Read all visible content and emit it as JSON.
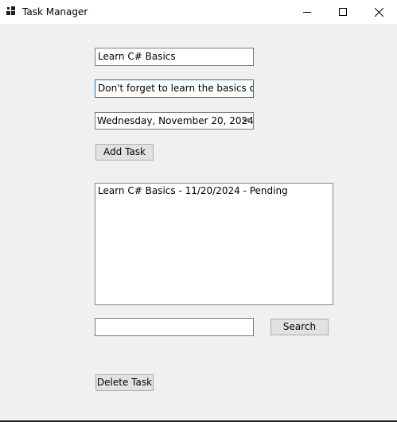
{
  "window": {
    "title": "Task Manager",
    "icon": "app-grid-icon",
    "controls": {
      "minimize_icon": "minimize-icon",
      "maximize_icon": "maximize-icon",
      "close_icon": "close-icon"
    }
  },
  "form": {
    "title_value": "Learn C# Basics",
    "description_value": "Don't forget to learn the basics of C#",
    "due_date_value": "Wednesday, November 20, 2024",
    "add_task_label": "Add Task",
    "tasks": [
      "Learn C# Basics - 11/20/2024 - Pending"
    ],
    "search_value": "",
    "search_label": "Search",
    "delete_task_label": "Delete Task"
  },
  "colors": {
    "window_bg": "#f0f0f0",
    "titlebar_bg": "#ffffff",
    "focus_border": "#0078d7",
    "button_bg": "#e1e1e1"
  }
}
